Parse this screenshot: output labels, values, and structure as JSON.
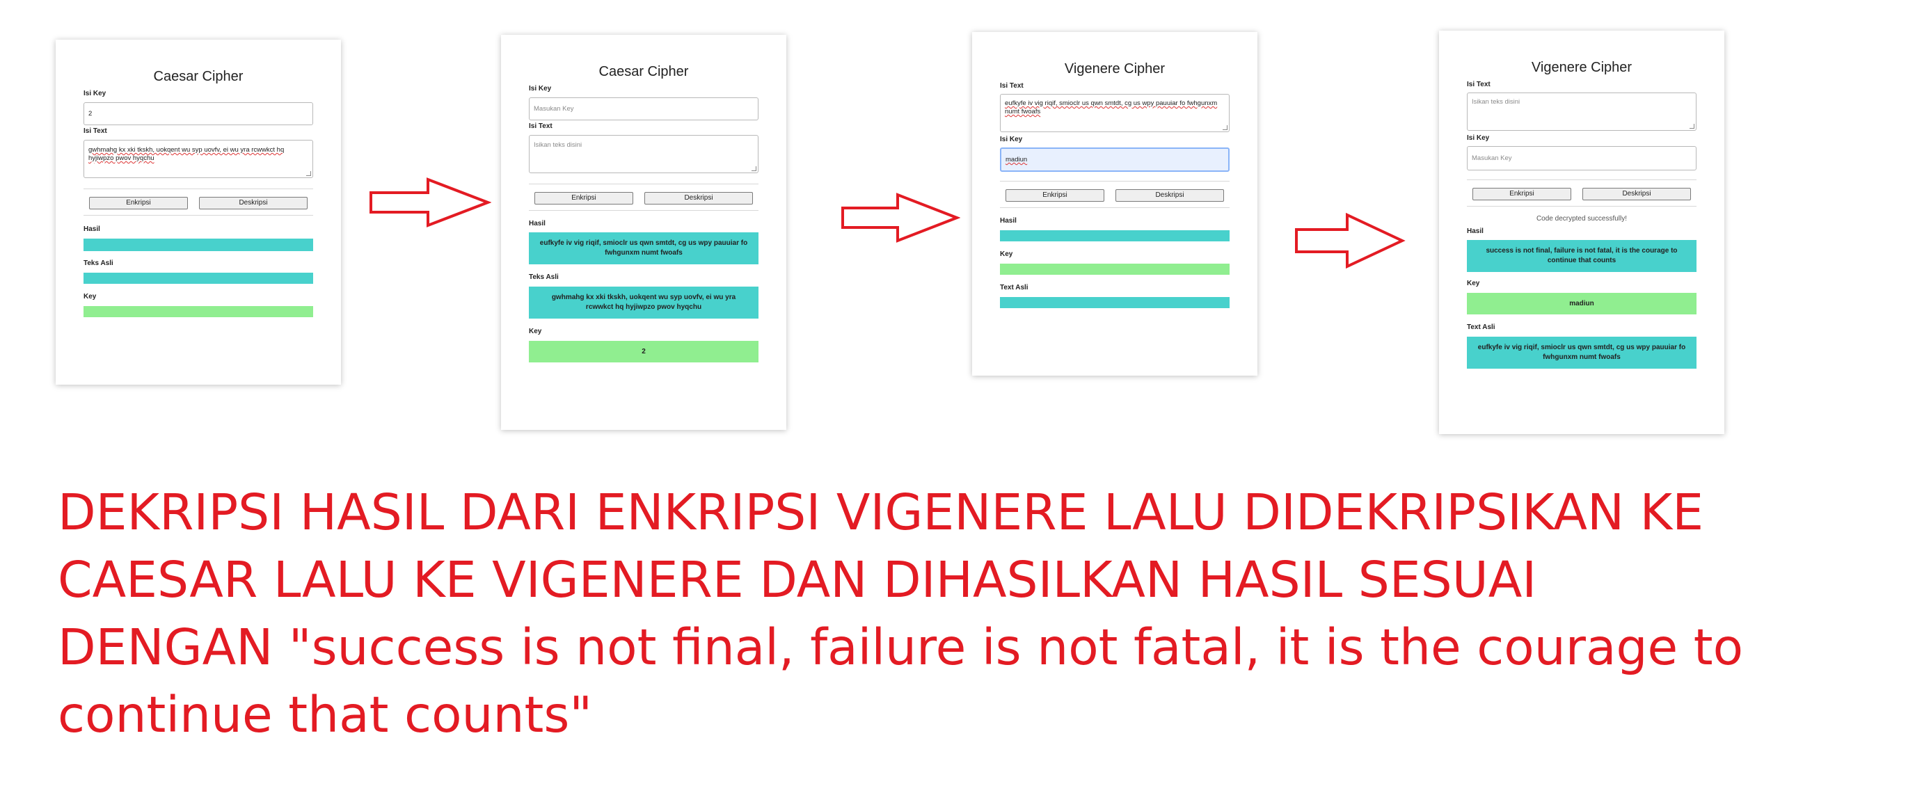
{
  "panel1": {
    "title": "Caesar Cipher",
    "key_label": "Isi Key",
    "key_value": "2",
    "text_label": "Isi Text",
    "text_value": "gwhmahg kx xki tkskh, uokqent wu syp uovfv, ei wu yra rcwwkct hq hyjiwpzo pwov hyqchu",
    "encrypt_label": "Enkripsi",
    "decrypt_label": "Deskripsi",
    "hasil_label": "Hasil",
    "teks_asli_label": "Teks Asli",
    "key_result_label": "Key"
  },
  "panel2": {
    "title": "Caesar Cipher",
    "key_label": "Isi Key",
    "key_placeholder": "Masukan Key",
    "text_label": "Isi Text",
    "text_placeholder": "Isikan teks disini",
    "encrypt_label": "Enkripsi",
    "decrypt_label": "Deskripsi",
    "hasil_label": "Hasil",
    "hasil_value": "eufkyfe iv vig riqif, smioclr us qwn smtdt, cg us wpy pauuiar fo fwhgunxm numt fwoafs",
    "teks_asli_label": "Teks Asli",
    "teks_asli_value": "gwhmahg kx xki tkskh, uokqent wu syp uovfv, ei wu yra rcwwkct hq hyjiwpzo pwov hyqchu",
    "key_result_label": "Key",
    "key_result_value": "2"
  },
  "panel3": {
    "title": "Vigenere Cipher",
    "text_label": "Isi Text",
    "text_value": "eufkyfe iv vig riqif, smioclr us qwn smtdt, cg us wpy pauuiar fo fwhgunxm numt fwoafs",
    "key_label": "Isi Key",
    "key_value": "madiun",
    "encrypt_label": "Enkripsi",
    "decrypt_label": "Deskripsi",
    "hasil_label": "Hasil",
    "key_result_label": "Key",
    "text_asli_label": "Text Asli"
  },
  "panel4": {
    "title": "Vigenere Cipher",
    "text_label": "Isi Text",
    "text_placeholder": "Isikan teks disini",
    "key_label": "Isi Key",
    "key_placeholder": "Masukan Key",
    "encrypt_label": "Enkripsi",
    "decrypt_label": "Deskripsi",
    "status_message": "Code decrypted successfully!",
    "hasil_label": "Hasil",
    "hasil_value": "success is not final, failure is not fatal, it is the courage to continue that counts",
    "key_result_label": "Key",
    "key_result_value": "madiun",
    "text_asli_label": "Text Asli",
    "text_asli_value": "eufkyfe iv vig riqif, smioclr us qwn smtdt, cg us wpy pauuiar fo fwhgunxm numt fwoafs"
  },
  "caption": {
    "line1": "DEKRIPSI HASIL DARI ENKRIPSI VIGENERE LALU DIDEKRIPSIKAN KE",
    "line2": "CAESAR LALU KE VIGENERE DAN DIHASILKAN HASIL SESUAI",
    "line3": "DENGAN \"success is not final, failure is not fatal, it is the courage to",
    "line4": "continue that counts\""
  },
  "colors": {
    "teal": "#48d1cc",
    "green": "#90ee90",
    "arrow": "#e31b23",
    "caption": "#e31b23"
  },
  "icons": [
    "right-arrow-icon"
  ]
}
